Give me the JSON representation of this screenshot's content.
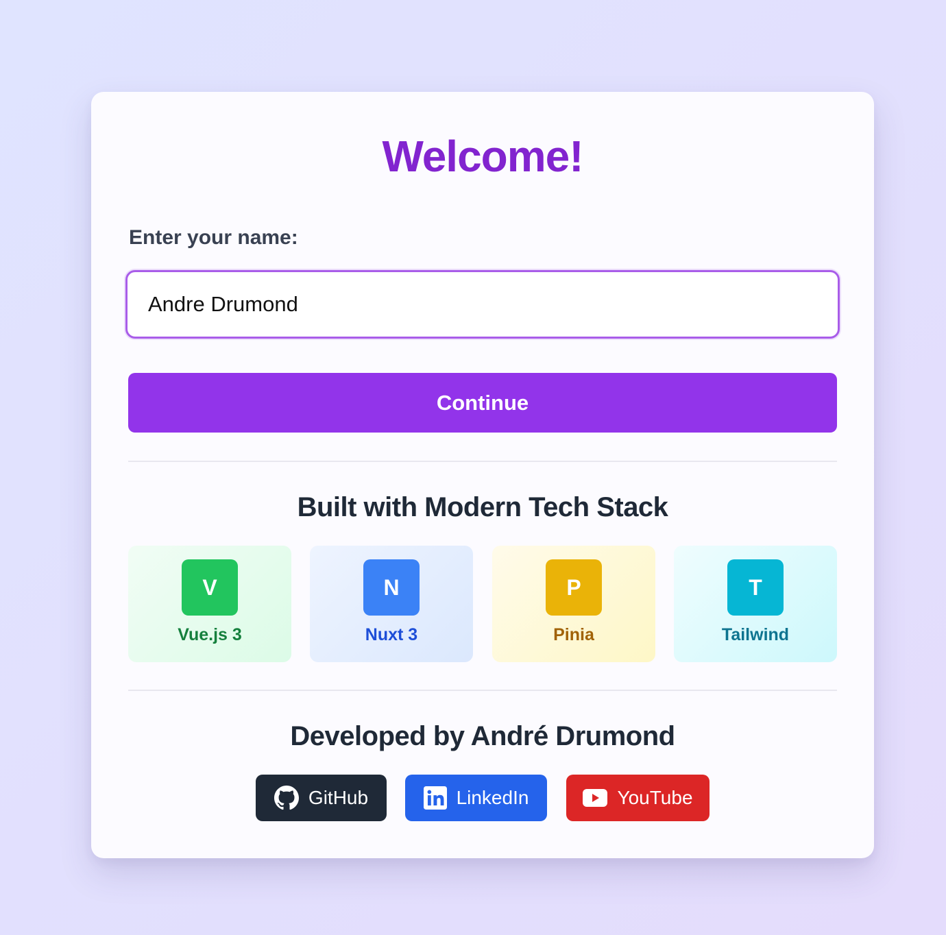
{
  "welcome": {
    "title": "Welcome!"
  },
  "name_form": {
    "label": "Enter your name:",
    "input_value": "Andre Drumond",
    "continue_label": "Continue"
  },
  "tech_stack": {
    "heading": "Built with Modern Tech Stack",
    "items": [
      {
        "letter": "V",
        "name": "Vue.js 3",
        "color": "#22c55e"
      },
      {
        "letter": "N",
        "name": "Nuxt 3",
        "color": "#3b82f6"
      },
      {
        "letter": "P",
        "name": "Pinia",
        "color": "#eab308"
      },
      {
        "letter": "T",
        "name": "Tailwind",
        "color": "#06b6d4"
      }
    ]
  },
  "developer": {
    "heading": "Developed by André Drumond",
    "links": [
      {
        "label": "GitHub",
        "icon": "github-icon",
        "color": "#1f2937"
      },
      {
        "label": "LinkedIn",
        "icon": "linkedin-icon",
        "color": "#2563eb"
      },
      {
        "label": "YouTube",
        "icon": "youtube-icon",
        "color": "#dc2626"
      }
    ]
  },
  "theme": {
    "accent": "#9234ea",
    "title_color": "#8224cf"
  }
}
